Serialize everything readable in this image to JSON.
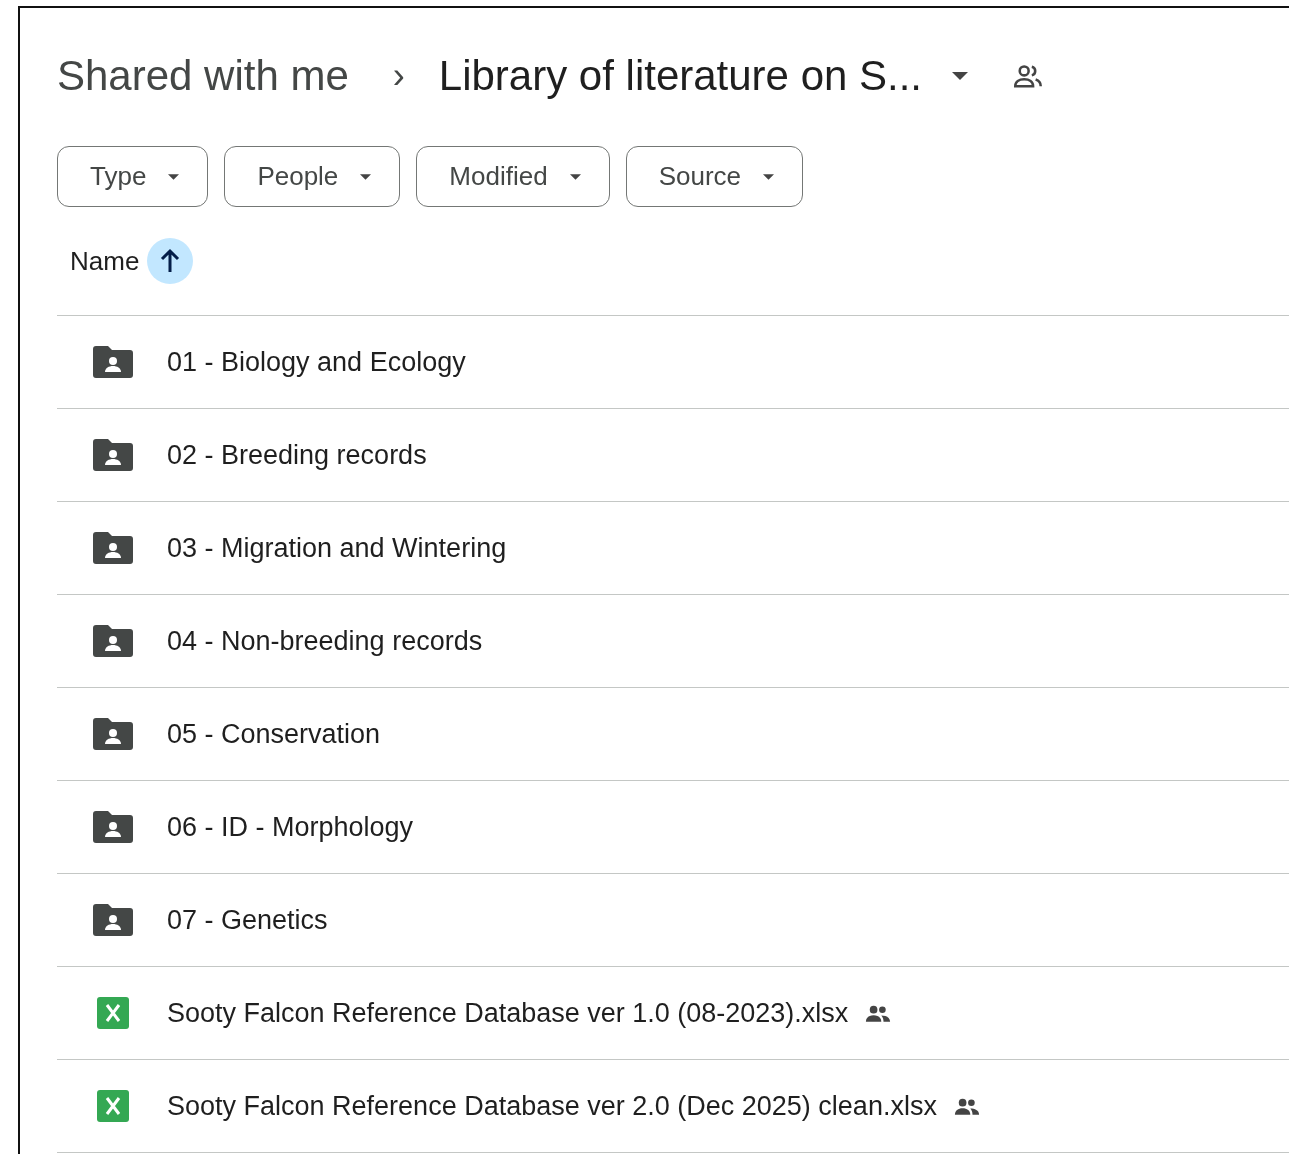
{
  "breadcrumb": {
    "parent": "Shared with me",
    "separator": "›",
    "current": "Library of literature on S...",
    "shared": true
  },
  "filters": [
    {
      "label": "Type"
    },
    {
      "label": "People"
    },
    {
      "label": "Modified"
    },
    {
      "label": "Source"
    }
  ],
  "table": {
    "sort_column": {
      "label": "Name",
      "ascending": true
    },
    "rows": [
      {
        "kind": "shared-folder",
        "name": "01 - Biology and Ecology",
        "shared": false
      },
      {
        "kind": "shared-folder",
        "name": "02 - Breeding records",
        "shared": false
      },
      {
        "kind": "shared-folder",
        "name": "03 - Migration and Wintering",
        "shared": false
      },
      {
        "kind": "shared-folder",
        "name": "04 - Non-breeding records",
        "shared": false
      },
      {
        "kind": "shared-folder",
        "name": "05 - Conservation",
        "shared": false
      },
      {
        "kind": "shared-folder",
        "name": "06 - ID - Morphology",
        "shared": false
      },
      {
        "kind": "shared-folder",
        "name": "07 - Genetics",
        "shared": false
      },
      {
        "kind": "spreadsheet",
        "name": "Sooty Falcon Reference Database ver 1.0 (08-2023).xlsx",
        "shared": true
      },
      {
        "kind": "spreadsheet",
        "name": "Sooty Falcon Reference Database ver 2.0 (Dec 2025) clean.xlsx",
        "shared": true
      }
    ]
  }
}
